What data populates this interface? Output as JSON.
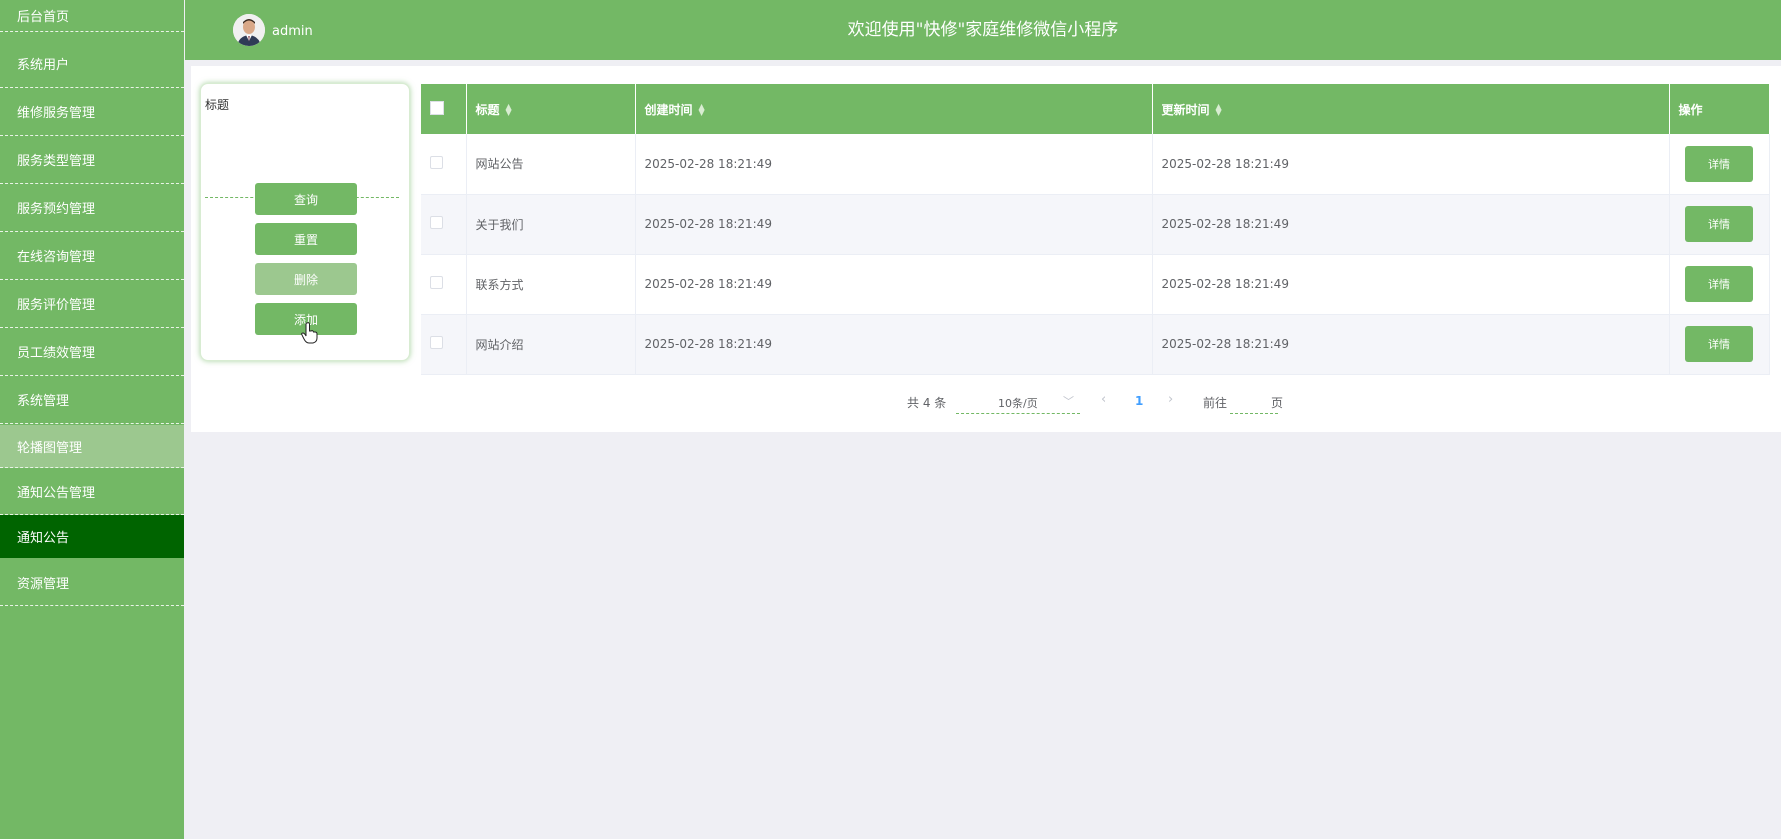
{
  "sidebar": {
    "items": [
      {
        "label": "后台首页",
        "state": "normal"
      },
      {
        "label": "系统用户",
        "state": "normal"
      },
      {
        "label": "维修服务管理",
        "state": "normal"
      },
      {
        "label": "服务类型管理",
        "state": "normal"
      },
      {
        "label": "服务预约管理",
        "state": "normal"
      },
      {
        "label": "在线咨询管理",
        "state": "normal"
      },
      {
        "label": "服务评价管理",
        "state": "normal"
      },
      {
        "label": "员工绩效管理",
        "state": "normal"
      },
      {
        "label": "系统管理",
        "state": "normal"
      },
      {
        "label": "轮播图管理",
        "state": "hover"
      },
      {
        "label": "通知公告管理",
        "state": "normal"
      },
      {
        "label": "通知公告",
        "state": "active"
      },
      {
        "label": "资源管理",
        "state": "normal"
      }
    ]
  },
  "header": {
    "username": "admin",
    "title": "欢迎使用\"快修\"家庭维修微信小程序"
  },
  "search": {
    "label": "标题",
    "input_value": "",
    "buttons": {
      "query": "查询",
      "reset": "重置",
      "delete": "删除",
      "add": "添加"
    }
  },
  "table": {
    "columns": {
      "title": "标题",
      "created": "创建时间",
      "updated": "更新时间",
      "action": "操作"
    },
    "rows": [
      {
        "title": "网站公告",
        "created": "2025-02-28 18:21:49",
        "updated": "2025-02-28 18:21:49",
        "action": "详情"
      },
      {
        "title": "关于我们",
        "created": "2025-02-28 18:21:49",
        "updated": "2025-02-28 18:21:49",
        "action": "详情"
      },
      {
        "title": "联系方式",
        "created": "2025-02-28 18:21:49",
        "updated": "2025-02-28 18:21:49",
        "action": "详情"
      },
      {
        "title": "网站介绍",
        "created": "2025-02-28 18:21:49",
        "updated": "2025-02-28 18:21:49",
        "action": "详情"
      }
    ]
  },
  "pagination": {
    "total_text": "共 4 条",
    "page_size": "10条/页",
    "current_page": "1",
    "goto_label": "前往",
    "page_unit": "页"
  },
  "colors": {
    "primary": "#73b865",
    "active_menu": "#006400",
    "hover_menu": "#9cc88f",
    "page_background": "#efeff4"
  }
}
